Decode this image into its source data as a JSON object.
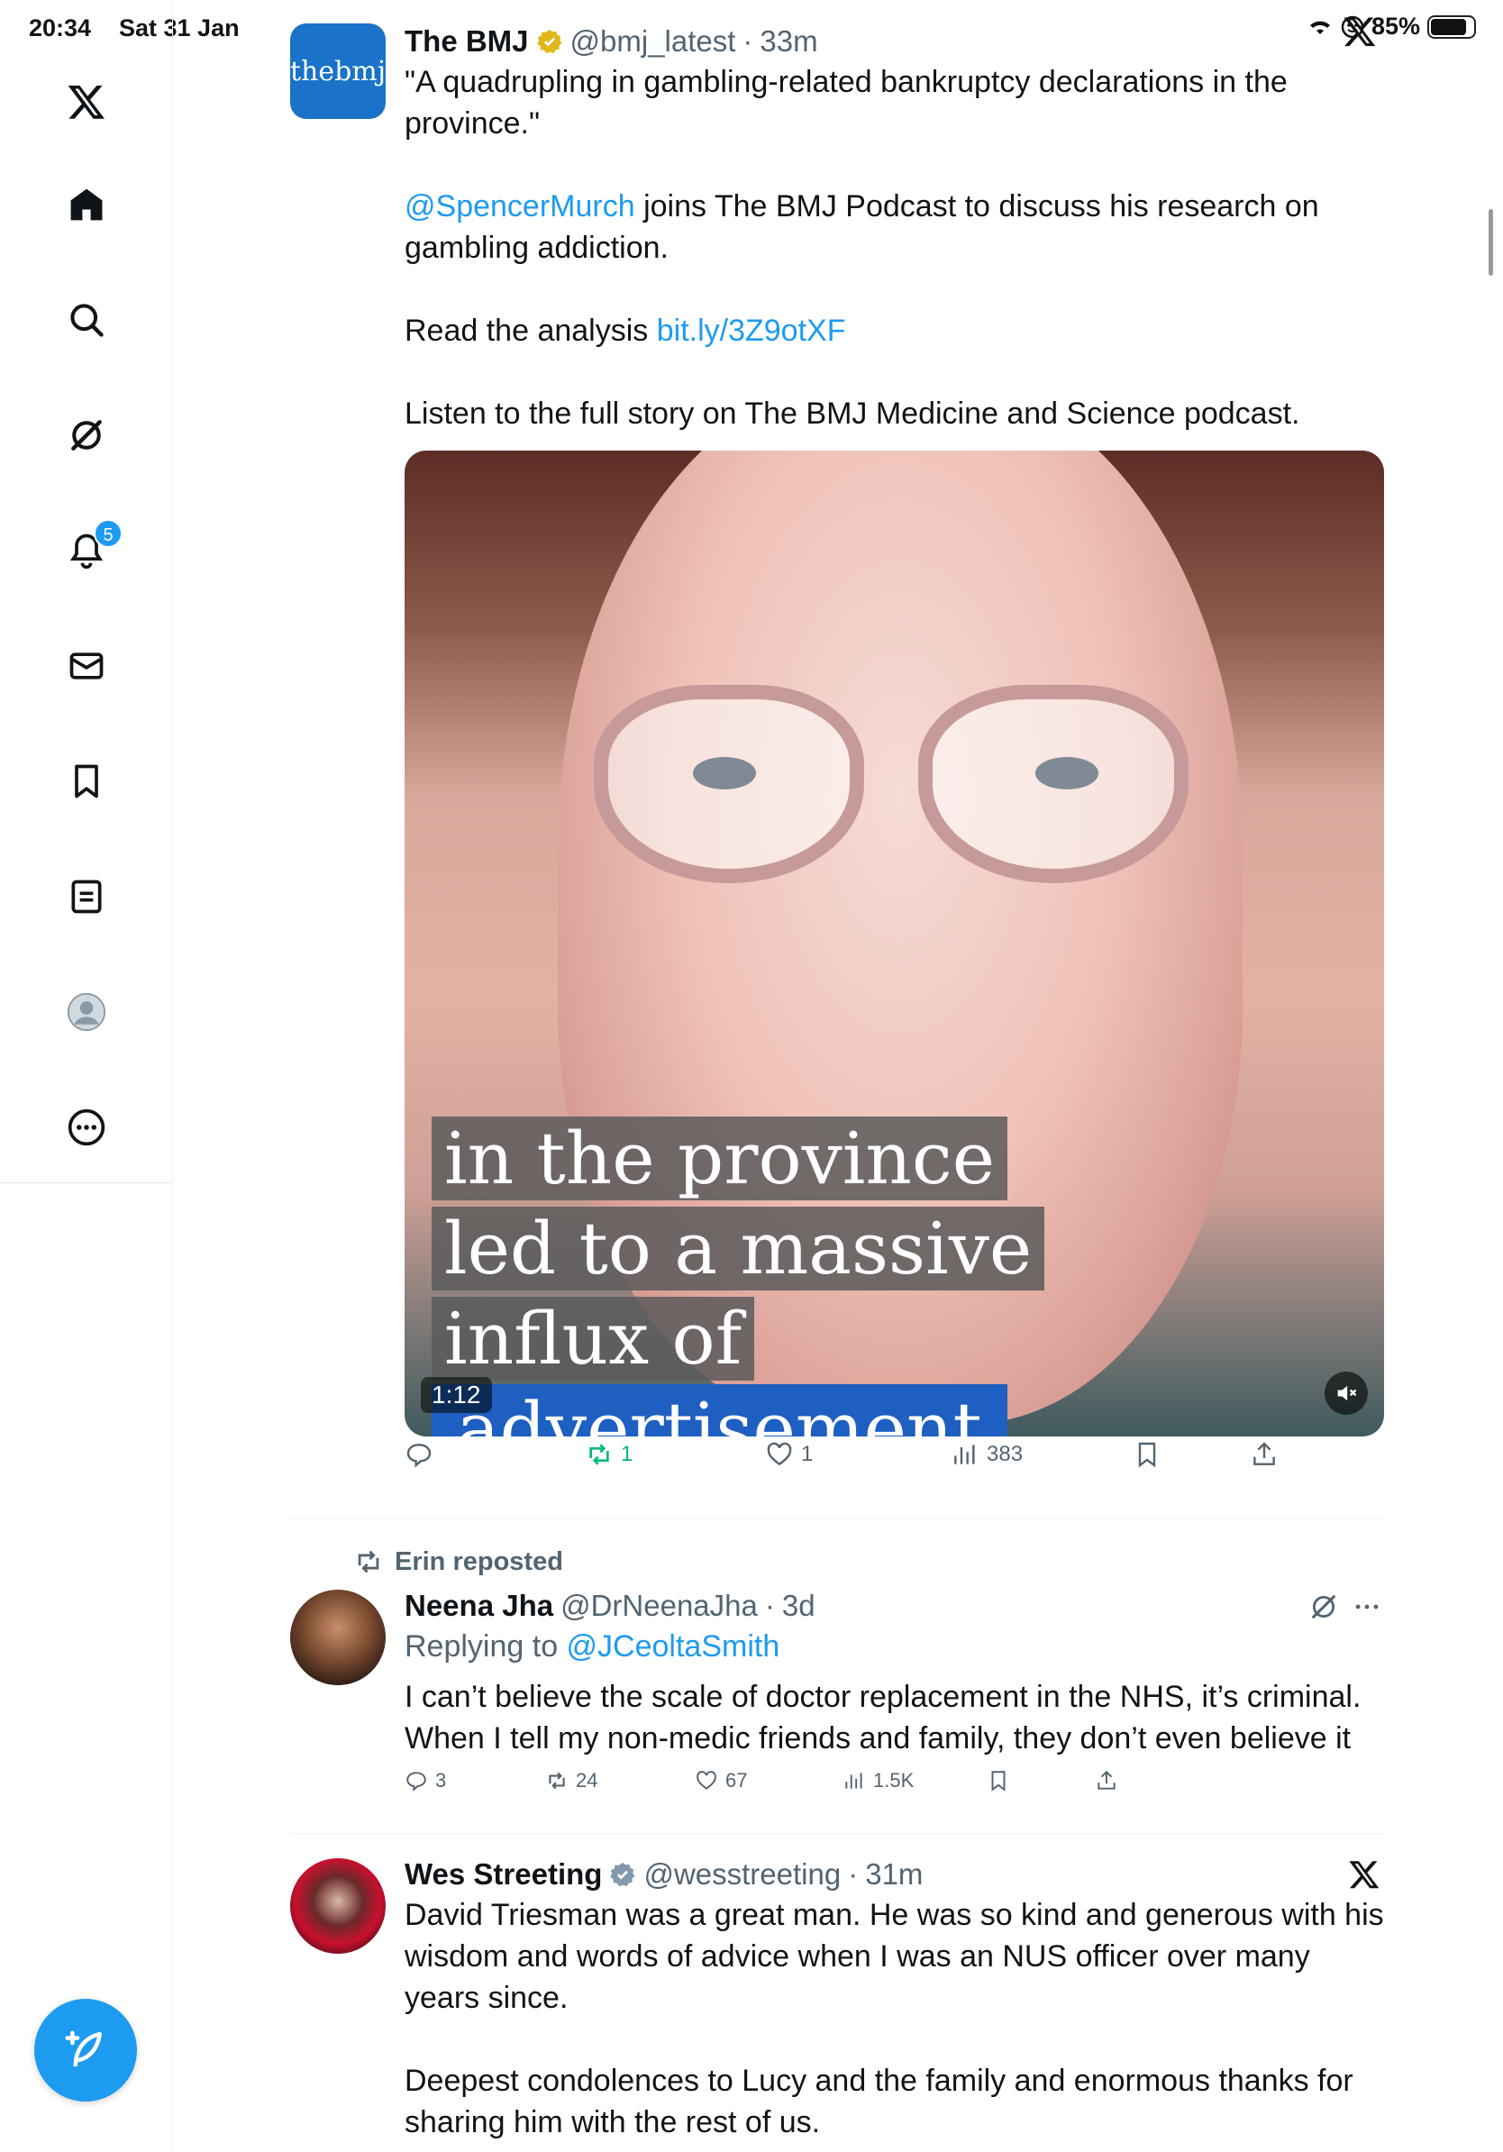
{
  "status_bar": {
    "time": "20:34",
    "date": "Sat 31 Jan",
    "battery": "85%"
  },
  "sidebar": {
    "notifications_badge": "5"
  },
  "tweets": [
    {
      "name": "The BMJ",
      "handle": "@bmj_latest",
      "dot": "·",
      "ago": "33m",
      "avatar_text": "thebmj",
      "line1": "\"A quadrupling in gambling-related bankruptcy declarations in the province.\"",
      "mention": "@SpencerMurch",
      "line2": " joins The BMJ Podcast to discuss his research on gambling addiction.",
      "line3_prefix": "Read the analysis ",
      "line3_link": "bit.ly/3Z9otXF",
      "line4": "Listen to the full story on The BMJ Medicine and Science podcast.",
      "video": {
        "caption1": "in the province",
        "caption2": "led to a massive",
        "caption3": "influx of",
        "caption4": "advertisement",
        "duration": "1:12"
      },
      "stats": {
        "replies": "",
        "reposts": "1",
        "likes": "1",
        "views": "383"
      }
    },
    {
      "reposted_by": "Erin reposted",
      "name": "Neena Jha",
      "handle": "@DrNeenaJha",
      "dot": "·",
      "ago": "3d",
      "replying_prefix": "Replying to ",
      "replying_to": "@JCeoltaSmith",
      "text": "I can’t believe the scale of doctor replacement in the NHS, it’s criminal. When I tell my non-medic friends and family, they don’t even believe it",
      "stats": {
        "replies": "3",
        "reposts": "24",
        "likes": "67",
        "views": "1.5K"
      }
    },
    {
      "name": "Wes Streeting",
      "handle": "@wesstreeting",
      "dot": "·",
      "ago": "31m",
      "para1": "David Triesman was a great man. He was so kind and generous with his wisdom and words of advice when I was an NUS officer over many years since.",
      "para2": "Deepest condolences to Lucy and the family and enormous thanks for sharing him with the rest of us."
    }
  ],
  "colors": {
    "accent": "#1d9bf0",
    "secondary_text": "#536471",
    "repost_green": "#00ba7c"
  },
  "icons": [
    "x-logo-icon",
    "home-icon",
    "search-icon",
    "grok-icon",
    "notifications-icon",
    "messages-icon",
    "bookmarks-icon",
    "lists-icon",
    "profile-icon",
    "more-icon",
    "compose-icon"
  ]
}
